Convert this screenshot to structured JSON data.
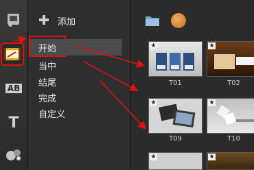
{
  "rail": {
    "items": [
      "media-icon",
      "title-template-icon",
      "ab-transition-icon",
      "text-icon",
      "effects-icon"
    ],
    "ab_text": "AB",
    "t_text": "T"
  },
  "panel": {
    "add_label": "添加",
    "categories": [
      "开始",
      "当中",
      "结尾",
      "完成",
      "自定义"
    ],
    "selected_index": 0
  },
  "library": {
    "thumbnails": [
      {
        "caption": "T01"
      },
      {
        "caption": "T02"
      },
      {
        "caption": "T09"
      },
      {
        "caption": "T10"
      },
      {
        "caption": ""
      },
      {
        "caption": ""
      }
    ]
  },
  "colors": {
    "annotation_red": "#e01010",
    "background": "#1e1e1e"
  }
}
